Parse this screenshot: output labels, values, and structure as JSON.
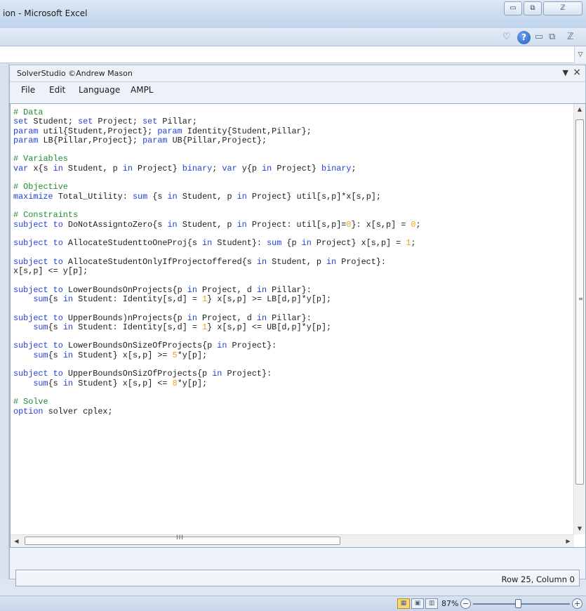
{
  "window": {
    "title": "ion - Microsoft Excel",
    "caption_minimize": "▭",
    "caption_restore": "⧉",
    "caption_close": "ℤ"
  },
  "ribbon": {
    "collapse_icon": "♡",
    "help_icon": "?",
    "doc_minimize_icon": "▭",
    "doc_restore_icon": "⧉",
    "doc_close_icon": "ℤ"
  },
  "formula_bar": {
    "expand_icon": "▽"
  },
  "pane": {
    "title": "SolverStudio ©Andrew Mason",
    "menu_arrow": "▼",
    "close": "×"
  },
  "menus": [
    "File",
    "Edit",
    "Language",
    "AMPL"
  ],
  "code_lines": [
    [
      {
        "t": "# Data",
        "c": "cm"
      }
    ],
    [
      {
        "t": "set",
        "c": "kw"
      },
      {
        "t": " Student; "
      },
      {
        "t": "set",
        "c": "kw"
      },
      {
        "t": " Project; "
      },
      {
        "t": "set",
        "c": "kw"
      },
      {
        "t": " Pillar;"
      }
    ],
    [
      {
        "t": "param",
        "c": "kw"
      },
      {
        "t": " util{Student,Project}; "
      },
      {
        "t": "param",
        "c": "kw"
      },
      {
        "t": " Identity{Student,Pillar};"
      }
    ],
    [
      {
        "t": "param",
        "c": "kw"
      },
      {
        "t": " LB{Pillar,Project}; "
      },
      {
        "t": "param",
        "c": "kw"
      },
      {
        "t": " UB{Pillar,Project};"
      }
    ],
    [],
    [
      {
        "t": "# Variables",
        "c": "cm"
      }
    ],
    [
      {
        "t": "var",
        "c": "kw"
      },
      {
        "t": " x{s "
      },
      {
        "t": "in",
        "c": "kw"
      },
      {
        "t": " Student, p "
      },
      {
        "t": "in",
        "c": "kw"
      },
      {
        "t": " Project} "
      },
      {
        "t": "binary",
        "c": "kw"
      },
      {
        "t": "; "
      },
      {
        "t": "var",
        "c": "kw"
      },
      {
        "t": " y{p "
      },
      {
        "t": "in",
        "c": "kw"
      },
      {
        "t": " Project} "
      },
      {
        "t": "binary",
        "c": "kw"
      },
      {
        "t": ";"
      }
    ],
    [],
    [
      {
        "t": "# Objective",
        "c": "cm"
      }
    ],
    [
      {
        "t": "maximize",
        "c": "kw"
      },
      {
        "t": " Total_Utility: "
      },
      {
        "t": "sum",
        "c": "kw"
      },
      {
        "t": " {s "
      },
      {
        "t": "in",
        "c": "kw"
      },
      {
        "t": " Student, p "
      },
      {
        "t": "in",
        "c": "kw"
      },
      {
        "t": " Project} util[s,p]*x[s,p];"
      }
    ],
    [],
    [
      {
        "t": "# Constraints",
        "c": "cm"
      }
    ],
    [
      {
        "t": "subject to",
        "c": "kw"
      },
      {
        "t": " DoNotAssigntoZero{s "
      },
      {
        "t": "in",
        "c": "kw"
      },
      {
        "t": " Student, p "
      },
      {
        "t": "in",
        "c": "kw"
      },
      {
        "t": " Project: util[s,p]="
      },
      {
        "t": "0",
        "c": "nm"
      },
      {
        "t": "}: x[s,p] = "
      },
      {
        "t": "0",
        "c": "nm"
      },
      {
        "t": ";"
      }
    ],
    [],
    [
      {
        "t": "subject to",
        "c": "kw"
      },
      {
        "t": " AllocateStudenttoOneProj{s "
      },
      {
        "t": "in",
        "c": "kw"
      },
      {
        "t": " Student}: "
      },
      {
        "t": "sum",
        "c": "kw"
      },
      {
        "t": " {p "
      },
      {
        "t": "in",
        "c": "kw"
      },
      {
        "t": " Project} x[s,p] = "
      },
      {
        "t": "1",
        "c": "nm"
      },
      {
        "t": ";"
      }
    ],
    [],
    [
      {
        "t": "subject to",
        "c": "kw"
      },
      {
        "t": " AllocateStudentOnlyIfProjectoffered{s "
      },
      {
        "t": "in",
        "c": "kw"
      },
      {
        "t": " Student, p "
      },
      {
        "t": "in",
        "c": "kw"
      },
      {
        "t": " Project}:"
      }
    ],
    [
      {
        "t": "x[s,p] <= y[p];"
      }
    ],
    [],
    [
      {
        "t": "subject to",
        "c": "kw"
      },
      {
        "t": " LowerBoundsOnProjects{p "
      },
      {
        "t": "in",
        "c": "kw"
      },
      {
        "t": " Project, d "
      },
      {
        "t": "in",
        "c": "kw"
      },
      {
        "t": " Pillar}:"
      }
    ],
    [
      {
        "t": "    "
      },
      {
        "t": "sum",
        "c": "kw"
      },
      {
        "t": "{s "
      },
      {
        "t": "in",
        "c": "kw"
      },
      {
        "t": " Student: Identity[s,d] = "
      },
      {
        "t": "1",
        "c": "nm"
      },
      {
        "t": "} x[s,p] >= LB[d,p]*y[p];"
      }
    ],
    [],
    [
      {
        "t": "subject to",
        "c": "kw"
      },
      {
        "t": " UpperBounds)nProjects{p "
      },
      {
        "t": "in",
        "c": "kw"
      },
      {
        "t": " Project, d "
      },
      {
        "t": "in",
        "c": "kw"
      },
      {
        "t": " Pillar}:"
      }
    ],
    [
      {
        "t": "    "
      },
      {
        "t": "sum",
        "c": "kw"
      },
      {
        "t": "{s "
      },
      {
        "t": "in",
        "c": "kw"
      },
      {
        "t": " Student: Identity[s,d] = "
      },
      {
        "t": "1",
        "c": "nm"
      },
      {
        "t": "} x[s,p] <= UB[d,p]*y[p];"
      }
    ],
    [],
    [
      {
        "t": "subject to",
        "c": "kw"
      },
      {
        "t": " LowerBoundsOnSizeOfProjects{p "
      },
      {
        "t": "in",
        "c": "kw"
      },
      {
        "t": " Project}:"
      }
    ],
    [
      {
        "t": "    "
      },
      {
        "t": "sum",
        "c": "kw"
      },
      {
        "t": "{s "
      },
      {
        "t": "in",
        "c": "kw"
      },
      {
        "t": " Student} x[s,p] >= "
      },
      {
        "t": "5",
        "c": "nm"
      },
      {
        "t": "*y[p];"
      }
    ],
    [],
    [
      {
        "t": "subject to",
        "c": "kw"
      },
      {
        "t": " UpperBoundsOnSizOfProjects{p "
      },
      {
        "t": "in",
        "c": "kw"
      },
      {
        "t": " Project}:"
      }
    ],
    [
      {
        "t": "    "
      },
      {
        "t": "sum",
        "c": "kw"
      },
      {
        "t": "{s "
      },
      {
        "t": "in",
        "c": "kw"
      },
      {
        "t": " Student} x[s,p] <= "
      },
      {
        "t": "8",
        "c": "nm"
      },
      {
        "t": "*y[p];"
      }
    ],
    [],
    [
      {
        "t": "# Solve",
        "c": "cm"
      }
    ],
    [
      {
        "t": "option",
        "c": "kw"
      },
      {
        "t": " solver cplex;"
      }
    ]
  ],
  "editor": {
    "scroll_up": "▲",
    "scroll_down": "▼",
    "scroll_left": "◀",
    "scroll_right": "▶",
    "vgrip": "≡",
    "hgrip": "III"
  },
  "status": {
    "position": "Row 25, Column 0"
  },
  "excel_status": {
    "zoom": "87%",
    "zoom_out": "−",
    "zoom_in": "+",
    "view_normal_icon": "▦",
    "view_layout_icon": "▣",
    "view_break_icon": "▥"
  }
}
